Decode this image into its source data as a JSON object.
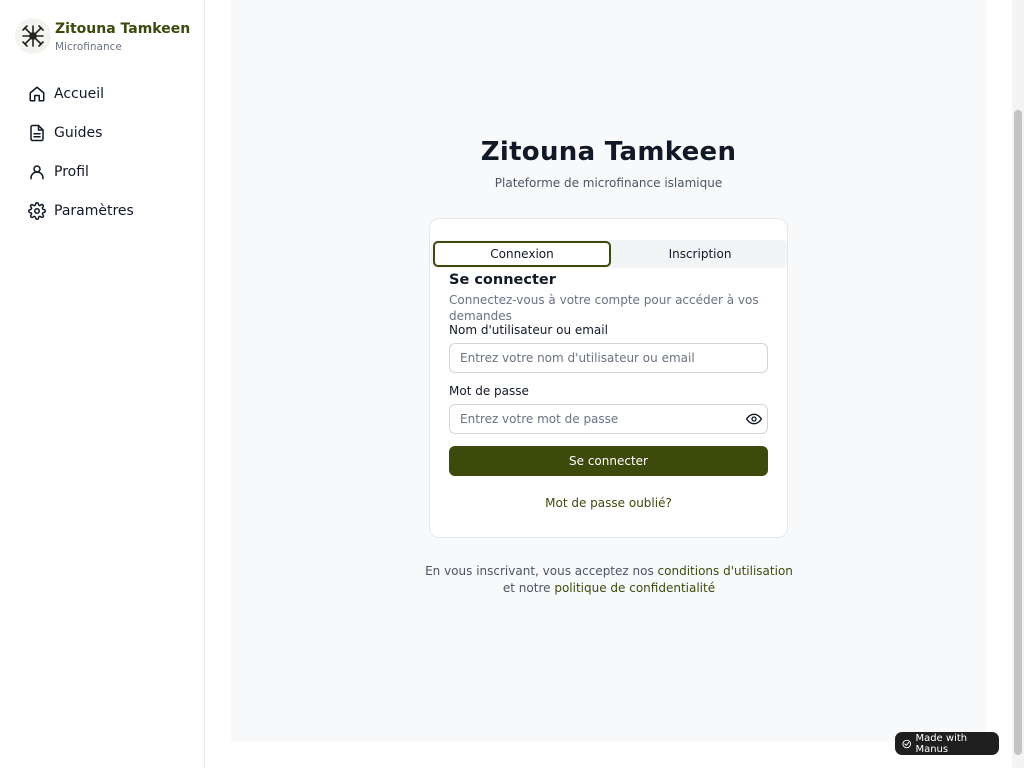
{
  "sidebar": {
    "brand": {
      "name": "Zitouna Tamkeen",
      "subtitle": "Microfinance",
      "logo_icon": "tree-logo-icon"
    },
    "items": [
      {
        "label": "Accueil",
        "icon": "home-icon"
      },
      {
        "label": "Guides",
        "icon": "document-icon"
      },
      {
        "label": "Profil",
        "icon": "user-icon"
      },
      {
        "label": "Paramètres",
        "icon": "gear-icon"
      }
    ]
  },
  "header": {
    "title": "Zitouna Tamkeen",
    "subtitle": "Plateforme de microfinance islamique"
  },
  "auth": {
    "tabs": [
      {
        "label": "Connexion",
        "active": true
      },
      {
        "label": "Inscription",
        "active": false
      }
    ],
    "title": "Se connecter",
    "description": "Connectez-vous à votre compte pour accéder à vos demandes",
    "username": {
      "label": "Nom d'utilisateur ou email",
      "placeholder": "Entrez votre nom d'utilisateur ou email",
      "value": ""
    },
    "password": {
      "label": "Mot de passe",
      "placeholder": "Entrez votre mot de passe",
      "value": "",
      "toggle_icon": "eye-icon"
    },
    "submit_label": "Se connecter",
    "forgot_label": "Mot de passe oublié?"
  },
  "terms": {
    "prefix": "En vous inscrivant, vous acceptez nos ",
    "terms_link": "conditions d'utilisation",
    "middle": " et notre ",
    "privacy_link": "politique de confidentialité"
  },
  "badge": {
    "label": "Made with Manus"
  },
  "colors": {
    "accent": "#3d4a0b",
    "brand_text": "#3a4a0a",
    "background": "#f8f9fb"
  }
}
